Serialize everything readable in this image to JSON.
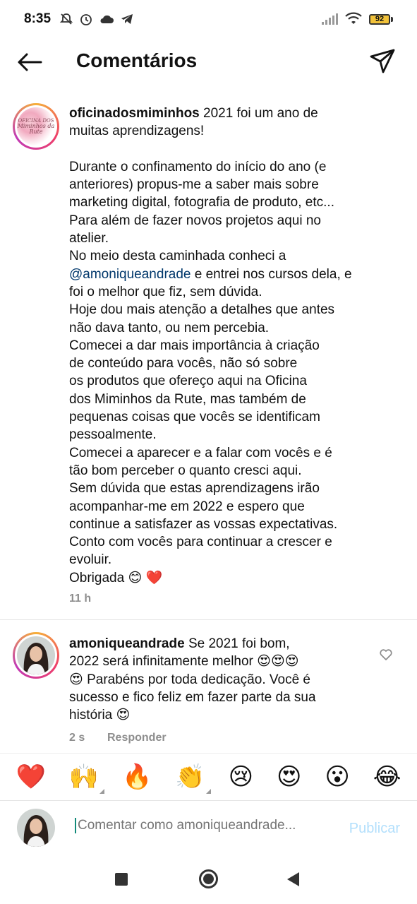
{
  "status_bar": {
    "time": "8:35",
    "battery": "92",
    "left_icons": [
      "mute-icon",
      "alarm-icon",
      "cloud-icon",
      "telegram-icon"
    ],
    "right_icons": [
      "signal-icon",
      "wifi-icon",
      "battery-icon"
    ]
  },
  "header": {
    "title": "Comentários",
    "back_icon": "arrow-left-icon",
    "share_icon": "direct-send-icon"
  },
  "caption": {
    "username": "oficinadosmiminhos",
    "lines": [
      "2021 foi um ano de",
      "muitas aprendizagens!",
      "",
      "Durante o confinamento do início do ano (e",
      "anteriores) propus-me a saber mais sobre",
      "marketing digital, fotografia de produto, etc...",
      "Para além de fazer novos projetos aqui no",
      "atelier.",
      "No meio desta caminhada conheci a"
    ],
    "mention": "@amoniqueandrade",
    "mention_suffix": " e entrei nos cursos dela, e",
    "lines_after": [
      "foi o melhor que fiz, sem dúvida.",
      "Hoje dou mais atenção a detalhes que antes",
      "não dava tanto, ou nem percebia.",
      "Comecei a dar mais importância à criação",
      "de conteúdo para vocês, não só sobre",
      "os produtos que ofereço aqui na Oficina",
      "dos Miminhos da Rute, mas também de",
      "pequenas coisas que vocês se identificam",
      "pessoalmente.",
      "Comecei a aparecer e a falar com vocês e é",
      "tão bom perceber o quanto cresci aqui.",
      "Sem dúvida que estas aprendizagens irão",
      "acompanhar-me em 2022 e espero que",
      "continue a satisfazer as vossas expectativas.",
      "Conto com vocês para continuar a crescer e",
      "evoluir.",
      "Obrigada 😊 ❤️"
    ],
    "time": "11 h",
    "avatar_logo_top": "OFICINA DOS",
    "avatar_logo_main": "Miminhos da Rute"
  },
  "reply": {
    "username": "amoniqueandrade",
    "lines": [
      "Se 2021 foi bom,",
      "2022 será infinitamente melhor 😍😍😍",
      "😍 Parabéns por toda dedicação. Você é",
      "sucesso e fico feliz em fazer parte da sua",
      "história 😍"
    ],
    "time": "2 s",
    "reply_label": "Responder"
  },
  "emoji_bar": [
    "❤️",
    "🙌",
    "🔥",
    "👏",
    "😢",
    "😍",
    "😮",
    "😂"
  ],
  "composer": {
    "placeholder": "Comentar como amoniqueandrade...",
    "publish_label": "Publicar"
  },
  "colors": {
    "mention": "#00376b",
    "meta_gray": "#8e8e8e",
    "publish_disabled": "#b2dffc",
    "story_ring": [
      "#f6b03a",
      "#ee3e6b",
      "#c13ab5"
    ]
  }
}
